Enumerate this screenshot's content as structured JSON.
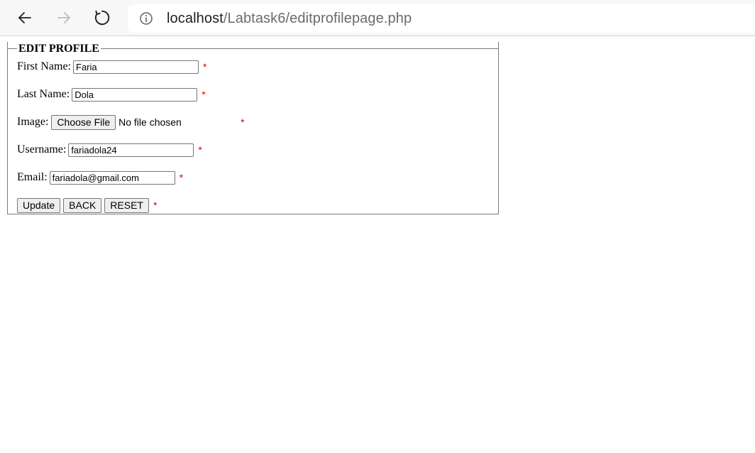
{
  "browser": {
    "url_host": "localhost",
    "url_path": "/Labtask6/editprofilepage.php"
  },
  "form": {
    "legend": "EDIT PROFILE",
    "required_mark": "*",
    "first_name": {
      "label": "First Name:",
      "value": "Faria"
    },
    "last_name": {
      "label": "Last Name:",
      "value": "Dola"
    },
    "image": {
      "label": "Image:",
      "button": "Choose File",
      "status": "No file chosen"
    },
    "username": {
      "label": "Username:",
      "value": "fariadola24"
    },
    "email": {
      "label": "Email:",
      "value": "fariadola@gmail.com"
    },
    "buttons": {
      "update": "Update",
      "back": "BACK",
      "reset": "RESET"
    }
  },
  "colors": {
    "required": "#e00000",
    "toolbar": "#f7f7f7"
  }
}
